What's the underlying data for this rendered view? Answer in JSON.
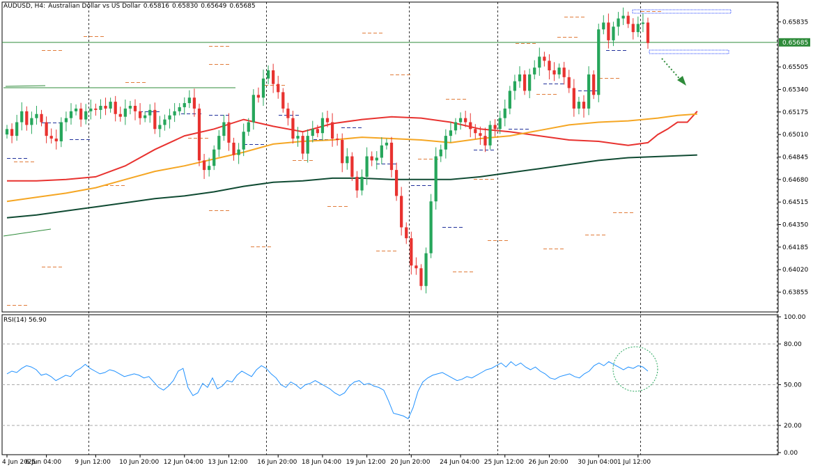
{
  "header": {
    "symbol": "AUDUSD, H4:",
    "description": "Australian Dollar vs US Dollar",
    "open": "0.65816",
    "high": "0.65830",
    "low": "0.65649",
    "close": "0.65685"
  },
  "rsi_header": {
    "label": "RSI(14)",
    "value": "56.90"
  },
  "current_price_label": "0.65685",
  "colors": {
    "bull": "#26a65b",
    "bear": "#e8322f",
    "ma_fast": "#e8322f",
    "ma_mid": "#f5a623",
    "ma_slow": "#0f4a32",
    "rsi": "#1e90ff",
    "price_line": "#2e8b3a",
    "level_dash": "#e07b39",
    "pivot_dash": "#1f2f9a"
  },
  "chart_data": [
    {
      "type": "candlestick",
      "title": "AUDUSD, H4: Australian Dollar vs US Dollar",
      "ylim": [
        0.6371,
        0.6598
      ],
      "y_ticks": [
        "0.65835",
        "0.65505",
        "0.65340",
        "0.65175",
        "0.65010",
        "0.64845",
        "0.64680",
        "0.64515",
        "0.64350",
        "0.64185",
        "0.64020",
        "0.63855"
      ],
      "y_tick_values": [
        0.65835,
        0.65505,
        0.6534,
        0.65175,
        0.6501,
        0.64845,
        0.6468,
        0.64515,
        0.6435,
        0.64185,
        0.6402,
        0.63855
      ],
      "x_ticks": [
        "4 Jun 2025",
        "6 Jun 04:00",
        "9 Jun 12:00",
        "10 Jun 20:00",
        "12 Jun 04:00",
        "13 Jun 12:00",
        "16 Jun 20:00",
        "18 Jun 04:00",
        "19 Jun 12:00",
        "20 Jun 20:00",
        "24 Jun 04:00",
        "25 Jun 12:00",
        "26 Jun 20:00",
        "30 Jun 04:00",
        "1 Jul 12:00"
      ],
      "close_series": [
        0.6505,
        0.65,
        0.651,
        0.6518,
        0.6508,
        0.6513,
        0.6516,
        0.651,
        0.65,
        0.6498,
        0.6496,
        0.651,
        0.6513,
        0.6518,
        0.652,
        0.6512,
        0.6518,
        0.652,
        0.6519,
        0.6522,
        0.652,
        0.6525,
        0.6516,
        0.6514,
        0.652,
        0.6522,
        0.6518,
        0.6513,
        0.6515,
        0.6519,
        0.6505,
        0.6508,
        0.6512,
        0.6515,
        0.6518,
        0.6521,
        0.6524,
        0.6528,
        0.652,
        0.6482,
        0.6475,
        0.6478,
        0.649,
        0.65,
        0.651,
        0.6495,
        0.6486,
        0.649,
        0.6503,
        0.651,
        0.653,
        0.6528,
        0.6542,
        0.6548,
        0.6538,
        0.6532,
        0.652,
        0.6513,
        0.6498,
        0.65,
        0.6487,
        0.65,
        0.6505,
        0.6502,
        0.6513,
        0.651,
        0.6498,
        0.6497,
        0.648,
        0.6485,
        0.647,
        0.646,
        0.647,
        0.6485,
        0.6482,
        0.6484,
        0.6493,
        0.6495,
        0.6475,
        0.6456,
        0.6433,
        0.6425,
        0.6405,
        0.6403,
        0.639,
        0.6414,
        0.6452,
        0.6485,
        0.649,
        0.65,
        0.6504,
        0.651,
        0.6513,
        0.651,
        0.6505,
        0.6502,
        0.65,
        0.6493,
        0.6508,
        0.6505,
        0.6513,
        0.652,
        0.6533,
        0.654,
        0.6545,
        0.6533,
        0.6545,
        0.655,
        0.6558,
        0.6555,
        0.6548,
        0.6545,
        0.655,
        0.6543,
        0.6535,
        0.652,
        0.6525,
        0.652,
        0.6545,
        0.653,
        0.6578,
        0.6583,
        0.657,
        0.658,
        0.6586,
        0.6588,
        0.6582,
        0.6576,
        0.6582,
        0.6583,
        0.6568
      ],
      "moving_averages": [
        {
          "values": [
            0.6467,
            0.6467,
            0.6468,
            0.647,
            0.6478,
            0.649,
            0.65,
            0.6505,
            0.6512,
            0.6507,
            0.6503,
            0.6509,
            0.6512,
            0.6514,
            0.6513,
            0.651,
            0.6505,
            0.6503,
            0.65,
            0.6497,
            0.6496,
            0.6493,
            0.6495,
            0.6501,
            0.6505,
            0.651,
            0.651,
            0.6518
          ],
          "x_idx": [
            0,
            6,
            12,
            18,
            24,
            30,
            36,
            42,
            48,
            54,
            60,
            66,
            72,
            78,
            84,
            90,
            96,
            102,
            108,
            114,
            120,
            126,
            130,
            132,
            134,
            136,
            138,
            140
          ]
        },
        {
          "values": [
            0.6452,
            0.6455,
            0.6458,
            0.6462,
            0.6468,
            0.6474,
            0.6478,
            0.6483,
            0.6488,
            0.6494,
            0.6496,
            0.6497,
            0.6499,
            0.6498,
            0.6497,
            0.6495,
            0.6498,
            0.65,
            0.6504,
            0.6508,
            0.651,
            0.6511,
            0.6513,
            0.6515,
            0.6516
          ],
          "x_idx": [
            0,
            6,
            12,
            18,
            24,
            30,
            36,
            42,
            48,
            54,
            60,
            66,
            72,
            78,
            84,
            90,
            96,
            102,
            108,
            114,
            120,
            126,
            132,
            136,
            140
          ]
        },
        {
          "values": [
            0.644,
            0.6442,
            0.6445,
            0.6448,
            0.6451,
            0.6454,
            0.6456,
            0.6459,
            0.6463,
            0.6466,
            0.6467,
            0.6469,
            0.6469,
            0.6468,
            0.6468,
            0.6468,
            0.647,
            0.6473,
            0.6476,
            0.6479,
            0.6482,
            0.6484,
            0.6486
          ],
          "x_idx": [
            0,
            6,
            12,
            18,
            24,
            30,
            36,
            42,
            48,
            54,
            60,
            66,
            72,
            78,
            84,
            90,
            96,
            102,
            108,
            114,
            120,
            126,
            140
          ]
        }
      ]
    },
    {
      "type": "line",
      "title": "RSI(14) 56.90",
      "ylim": [
        0,
        100
      ],
      "y_ticks": [
        "100.00",
        "80.00",
        "50.00",
        "20.00",
        "0.00"
      ],
      "y_tick_values": [
        100,
        80,
        50,
        20,
        0
      ],
      "levels": [
        80,
        50,
        20
      ],
      "series": [
        {
          "values": [
            58,
            60,
            59,
            62,
            64,
            63,
            61,
            57,
            58,
            56,
            53,
            55,
            57,
            56,
            60,
            62,
            65,
            62,
            60,
            58,
            59,
            61,
            60,
            58,
            56,
            57,
            58,
            57,
            55,
            56,
            52,
            48,
            46,
            49,
            53,
            60,
            62,
            48,
            42,
            44,
            51,
            48,
            55,
            47,
            49,
            53,
            52,
            57,
            60,
            58,
            56,
            61,
            64,
            62,
            58,
            55,
            50,
            48,
            52,
            50,
            47,
            50,
            51,
            53,
            51,
            49,
            47,
            44,
            42,
            44,
            49,
            52,
            53,
            50,
            51,
            49,
            48,
            46,
            38,
            29,
            28,
            27,
            25,
            33,
            45,
            52,
            55,
            57,
            58,
            59,
            57,
            55,
            53,
            54,
            56,
            55,
            57,
            59,
            61,
            62,
            64,
            66,
            63,
            67,
            64,
            66,
            63,
            61,
            63,
            60,
            58,
            55,
            54,
            56,
            57,
            58,
            56,
            55,
            58,
            60,
            64,
            66,
            64,
            67,
            65,
            63,
            61,
            63,
            62,
            64,
            63,
            60
          ]
        }
      ]
    }
  ]
}
